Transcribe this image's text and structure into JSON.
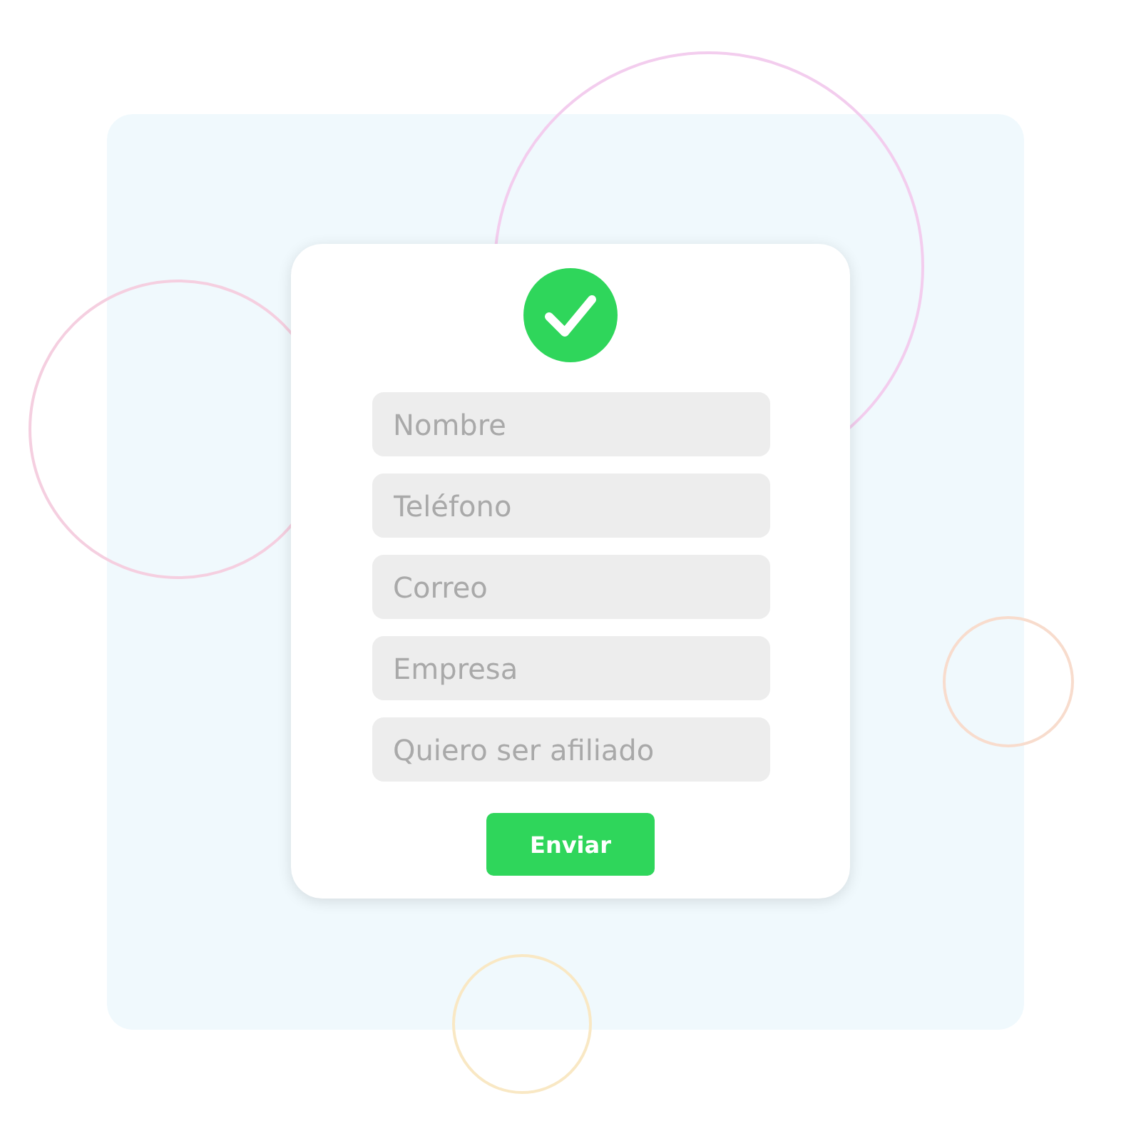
{
  "form": {
    "fields": [
      {
        "placeholder": "Nombre"
      },
      {
        "placeholder": "Teléfono"
      },
      {
        "placeholder": "Correo"
      },
      {
        "placeholder": "Empresa"
      },
      {
        "placeholder": "Quiero ser afiliado"
      }
    ],
    "submit": "Enviar"
  }
}
